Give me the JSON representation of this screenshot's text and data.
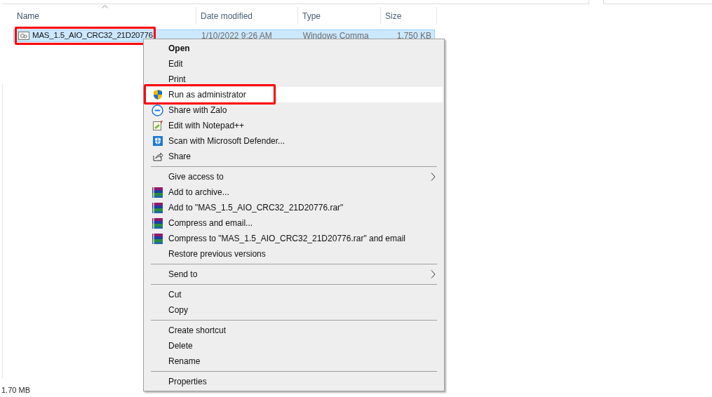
{
  "columns": [
    {
      "label": "Name",
      "sorted": true
    },
    {
      "label": "Date modified",
      "sorted": false
    },
    {
      "label": "Type",
      "sorted": false
    },
    {
      "label": "Size",
      "sorted": false
    }
  ],
  "file": {
    "name": "MAS_1.5_AIO_CRC32_21D20776",
    "date": "1/10/2022 9:26 AM",
    "type": "Windows Comma",
    "size": "1,750 KB",
    "selected": true,
    "highlighted": true
  },
  "context_menu": {
    "groups": [
      [
        {
          "label": "Open",
          "bold": true
        },
        {
          "label": "Edit"
        },
        {
          "label": "Print"
        },
        {
          "label": "Run as administrator",
          "kind": "shield",
          "hovered": true,
          "highlighted": true
        },
        {
          "label": "Share with Zalo",
          "kind": "zalo"
        },
        {
          "label": "Edit with Notepad++",
          "kind": "notepad"
        },
        {
          "label": "Scan with Microsoft Defender...",
          "kind": "defender"
        },
        {
          "label": "Share",
          "kind": "share"
        }
      ],
      [
        {
          "label": "Give access to",
          "submenu": true
        },
        {
          "label": "Add to archive...",
          "kind": "winrar"
        },
        {
          "label": "Add to \"MAS_1.5_AIO_CRC32_21D20776.rar\"",
          "kind": "winrar"
        },
        {
          "label": "Compress and email...",
          "kind": "winrar"
        },
        {
          "label": "Compress to \"MAS_1.5_AIO_CRC32_21D20776.rar\" and email",
          "kind": "winrar"
        },
        {
          "label": "Restore previous versions"
        }
      ],
      [
        {
          "label": "Send to",
          "submenu": true
        }
      ],
      [
        {
          "label": "Cut"
        },
        {
          "label": "Copy"
        }
      ],
      [
        {
          "label": "Create shortcut"
        },
        {
          "label": "Delete"
        },
        {
          "label": "Rename"
        }
      ],
      [
        {
          "label": "Properties"
        }
      ]
    ]
  },
  "status_bar": {
    "selection_size": "1.70 MB"
  }
}
